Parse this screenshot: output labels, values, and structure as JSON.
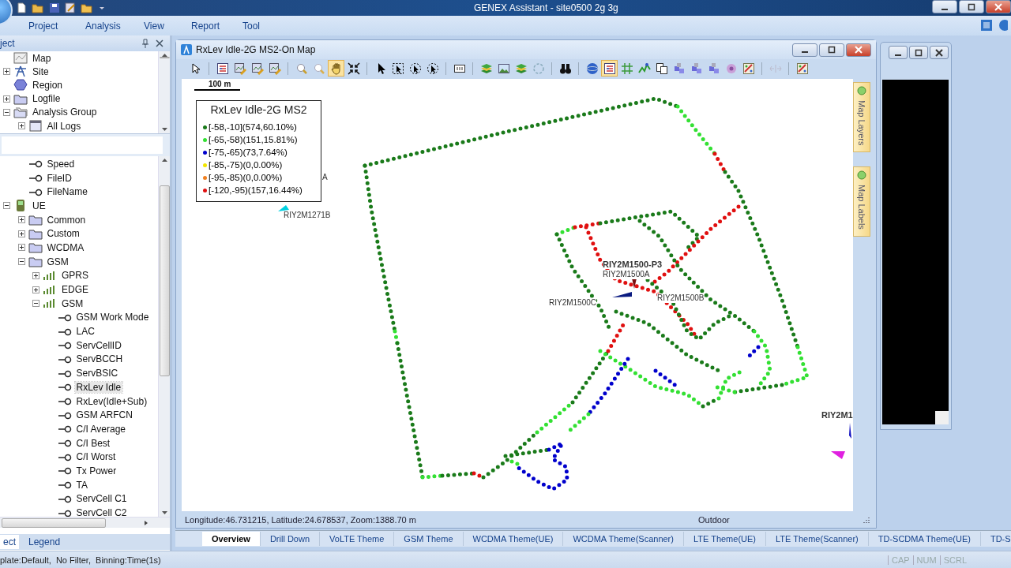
{
  "app": {
    "title": "GENEX Assistant - site0500 2g 3g"
  },
  "menu": [
    "Project",
    "Analysis",
    "View",
    "Report",
    "Tool"
  ],
  "left_panel": {
    "title": "ject",
    "upper_tree": [
      {
        "label": "Map",
        "kind": "map",
        "selected": false
      },
      {
        "label": "Site",
        "kind": "site",
        "expanded": false,
        "selected": false
      },
      {
        "label": "Region",
        "kind": "region",
        "selected": false
      },
      {
        "label": "Logfile",
        "kind": "folder",
        "expanded": false,
        "selected": false
      },
      {
        "label": "Analysis Group",
        "kind": "group",
        "expanded": true,
        "selected": false,
        "children": [
          {
            "label": "All Logs",
            "kind": "window",
            "expanded": false,
            "selected": false
          }
        ]
      }
    ],
    "lower_tree": {
      "continued": [
        {
          "label": "Speed",
          "kind": "param",
          "selected": false
        },
        {
          "label": "FileID",
          "kind": "param",
          "selected": false
        },
        {
          "label": "FileName",
          "kind": "param",
          "selected": false
        }
      ],
      "items": [
        {
          "label": "UE",
          "kind": "device",
          "expanded": true,
          "selected": false,
          "children": [
            {
              "label": "Common",
              "kind": "folder",
              "expanded": false,
              "selected": false
            },
            {
              "label": "Custom",
              "kind": "folder",
              "expanded": false,
              "selected": false
            },
            {
              "label": "WCDMA",
              "kind": "folder",
              "expanded": false,
              "selected": false
            },
            {
              "label": "GSM",
              "kind": "folder",
              "expanded": true,
              "selected": false,
              "children": [
                {
                  "label": "GPRS",
                  "kind": "network",
                  "expanded": false,
                  "selected": false
                },
                {
                  "label": "EDGE",
                  "kind": "network",
                  "expanded": false,
                  "selected": false
                },
                {
                  "label": "GSM",
                  "kind": "network",
                  "expanded": true,
                  "selected": false,
                  "children": [
                    {
                      "label": "GSM Work Mode",
                      "kind": "param",
                      "selected": false
                    },
                    {
                      "label": "LAC",
                      "kind": "param",
                      "selected": false
                    },
                    {
                      "label": "ServCellID",
                      "kind": "param",
                      "selected": false
                    },
                    {
                      "label": "ServBCCH",
                      "kind": "param",
                      "selected": false
                    },
                    {
                      "label": "ServBSIC",
                      "kind": "param",
                      "selected": false
                    },
                    {
                      "label": "RxLev Idle",
                      "kind": "param",
                      "selected": true
                    },
                    {
                      "label": "RxLev(Idle+Sub)",
                      "kind": "param",
                      "selected": false
                    },
                    {
                      "label": "GSM ARFCN",
                      "kind": "param",
                      "selected": false
                    },
                    {
                      "label": "C/I Average",
                      "kind": "param",
                      "selected": false
                    },
                    {
                      "label": "C/I Best",
                      "kind": "param",
                      "selected": false
                    },
                    {
                      "label": "C/I Worst",
                      "kind": "param",
                      "selected": false
                    },
                    {
                      "label": "Tx Power",
                      "kind": "param",
                      "selected": false
                    },
                    {
                      "label": "TA",
                      "kind": "param",
                      "selected": false
                    },
                    {
                      "label": "ServCell C1",
                      "kind": "param",
                      "selected": false
                    },
                    {
                      "label": "ServCell C2",
                      "kind": "param",
                      "selected": false
                    }
                  ]
                }
              ]
            }
          ]
        }
      ]
    },
    "bottom_tabs": [
      {
        "label": "ect",
        "selected": true
      },
      {
        "label": "Legend",
        "selected": false
      }
    ]
  },
  "map_window": {
    "title": "RxLev Idle-2G MS2-On Map",
    "toolbar": [
      {
        "kind": "pointer",
        "selected": false
      },
      {
        "kind": "separator"
      },
      {
        "kind": "legend",
        "selected": false
      },
      {
        "kind": "image-edit",
        "selected": false
      },
      {
        "kind": "image-edit",
        "selected": false
      },
      {
        "kind": "image-edit",
        "selected": false
      },
      {
        "kind": "separator"
      },
      {
        "kind": "zoom-in",
        "selected": false
      },
      {
        "kind": "zoom-out",
        "selected": false
      },
      {
        "kind": "hand",
        "selected": true
      },
      {
        "kind": "fit",
        "selected": false
      },
      {
        "kind": "separator"
      },
      {
        "kind": "select",
        "selected": false
      },
      {
        "kind": "rect-select",
        "selected": false
      },
      {
        "kind": "circle-select",
        "selected": false
      },
      {
        "kind": "circle-select",
        "selected": false
      },
      {
        "kind": "separator"
      },
      {
        "kind": "ruler",
        "selected": false
      },
      {
        "kind": "separator"
      },
      {
        "kind": "layers",
        "selected": false
      },
      {
        "kind": "picture",
        "selected": false
      },
      {
        "kind": "layers",
        "selected": false
      },
      {
        "kind": "refresh",
        "selected": false
      },
      {
        "kind": "separator"
      },
      {
        "kind": "binoculars",
        "selected": false
      },
      {
        "kind": "separator"
      },
      {
        "kind": "globe",
        "selected": false
      },
      {
        "kind": "legend",
        "selected": true
      },
      {
        "kind": "grid",
        "selected": false
      },
      {
        "kind": "chart",
        "selected": false
      },
      {
        "kind": "copy",
        "selected": false
      },
      {
        "kind": "cubes",
        "selected": false
      },
      {
        "kind": "cubes",
        "selected": false
      },
      {
        "kind": "cubes",
        "selected": false
      },
      {
        "kind": "flower",
        "selected": false
      },
      {
        "kind": "palette",
        "selected": false
      },
      {
        "kind": "separator"
      },
      {
        "kind": "arrows",
        "selected": false
      },
      {
        "kind": "separator"
      },
      {
        "kind": "palette",
        "selected": false
      }
    ],
    "scale": "100 m",
    "legend": {
      "title": "RxLev Idle-2G MS2",
      "items": [
        {
          "label": "[-58,-10](574,60.10%)",
          "color": "#1a7a1a"
        },
        {
          "label": "[-65,-58)(151,15.81%)",
          "color": "#33e033"
        },
        {
          "label": "[-75,-65)(73,7.64%)",
          "color": "#0000cc"
        },
        {
          "label": "[-85,-75)(0,0.00%)",
          "color": "#f2e600"
        },
        {
          "label": "[-95,-85)(0,0.00%)",
          "color": "#f08020"
        },
        {
          "label": "[-120,-95)(157,16.44%)",
          "color": "#e01010"
        }
      ]
    },
    "map_labels": [
      {
        "text": "A",
        "bold": false
      },
      {
        "text": "RIY2M1271B",
        "bold": false
      },
      {
        "text": "RIY2M1500-P3",
        "bold": true
      },
      {
        "text": "RIY2M1500A",
        "bold": false
      },
      {
        "text": "RIY2M1500C",
        "bold": false
      },
      {
        "text": "RIY2M1500B",
        "bold": false
      },
      {
        "text": "RIY2M1",
        "bold": true
      }
    ],
    "side_tabs": [
      "Map Layers",
      "Map Labels"
    ],
    "status": {
      "position": "Longitude:46.731215, Latitude:24.678537, Zoom:1388.70 m",
      "environment": "Outdoor"
    }
  },
  "theme_tabs": [
    {
      "label": "Overview",
      "selected": true
    },
    {
      "label": "Drill Down",
      "selected": false
    },
    {
      "label": "VoLTE Theme",
      "selected": false
    },
    {
      "label": "GSM Theme",
      "selected": false
    },
    {
      "label": "WCDMA Theme(UE)",
      "selected": false
    },
    {
      "label": "WCDMA Theme(Scanner)",
      "selected": false
    },
    {
      "label": "LTE Theme(UE)",
      "selected": false
    },
    {
      "label": "LTE Theme(Scanner)",
      "selected": false
    },
    {
      "label": "TD-SCDMA Theme(UE)",
      "selected": false
    },
    {
      "label": "TD-S",
      "selected": false
    }
  ],
  "status_bar": {
    "text": "plate:Default,  No Filter,  Binning:Time(1s)",
    "indicators": [
      {
        "label": "CAP",
        "on": false
      },
      {
        "label": "NUM",
        "on": false
      },
      {
        "label": "SCRL",
        "on": false
      }
    ]
  }
}
